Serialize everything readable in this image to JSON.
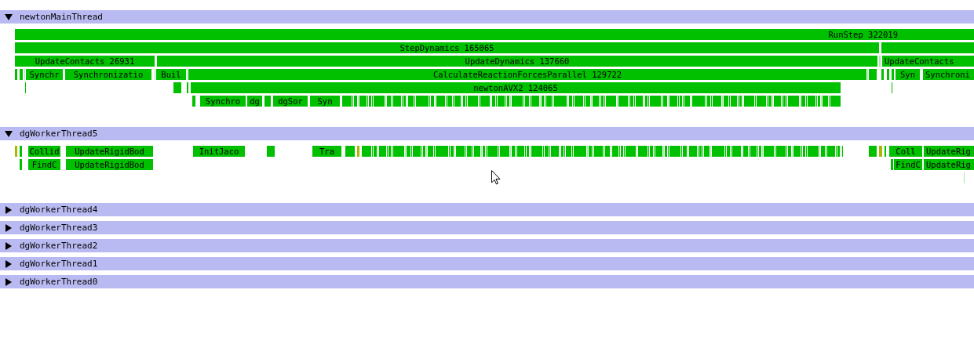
{
  "threads": [
    {
      "name": "newtonMainThread",
      "expanded": true,
      "lanes": [
        [
          {
            "label": "RunStep 322019"
          }
        ],
        [
          {
            "label": "StepDynamics 165065"
          }
        ],
        [
          {
            "label": "UpdateContacts 26931"
          },
          {
            "label": "UpdateDynamics 137660"
          },
          {
            "label": "UpdateContacts"
          }
        ],
        [
          {
            "label": "Synchr"
          },
          {
            "label": "Synchronizatio"
          },
          {
            "label": "Buil"
          },
          {
            "label": "CalculateReactionForcesParallel 129722"
          },
          {
            "label": "Syn"
          },
          {
            "label": "Synchroni"
          }
        ],
        [
          {
            "label": "newtonAVX2 124065"
          }
        ],
        [
          {
            "label": "Synchro"
          },
          {
            "label": "dg"
          },
          {
            "label": "dgSor"
          },
          {
            "label": "Syn"
          }
        ]
      ]
    },
    {
      "name": "dgWorkerThread5",
      "expanded": true,
      "lanes": [
        [
          {
            "label": "Collid"
          },
          {
            "label": "UpdateRigidBod"
          },
          {
            "label": "InitJaco"
          },
          {
            "label": "Tra"
          },
          {
            "label": "Coll"
          },
          {
            "label": "UpdateRig"
          }
        ],
        [
          {
            "label": "FindC"
          },
          {
            "label": "UpdateRigidBod"
          },
          {
            "label": "FindC"
          },
          {
            "label": "UpdateRig"
          }
        ]
      ]
    },
    {
      "name": "dgWorkerThread4",
      "expanded": false
    },
    {
      "name": "dgWorkerThread3",
      "expanded": false
    },
    {
      "name": "dgWorkerThread2",
      "expanded": false
    },
    {
      "name": "dgWorkerThread1",
      "expanded": false
    },
    {
      "name": "dgWorkerThread0",
      "expanded": false
    }
  ]
}
